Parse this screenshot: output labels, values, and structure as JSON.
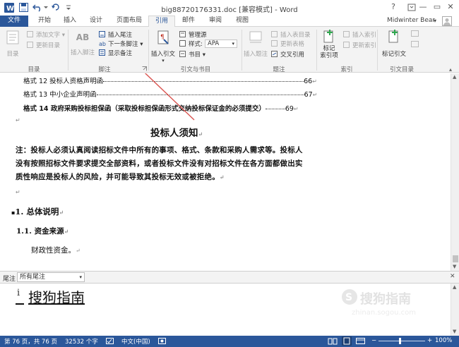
{
  "window": {
    "title": "big88720176331.doc [兼容模式] - Word",
    "help_glyph": "?",
    "min_glyph": "—",
    "restore_glyph": "▭",
    "close_glyph": "✕"
  },
  "tabs": {
    "file": "文件",
    "items": [
      "开始",
      "插入",
      "设计",
      "页面布局",
      "引用",
      "邮件",
      "审阅",
      "视图"
    ],
    "active": "引用",
    "user": "Midwinter Bear",
    "user_arrow": "▾"
  },
  "ribbon": {
    "toc": {
      "big": "目录",
      "add_text": "添加文字",
      "update": "更新目录",
      "group": "目录"
    },
    "footnotes": {
      "big": "插入脚注",
      "ab_glyph": "AB",
      "insert_endnote": "插入尾注",
      "next_footnote": "下一条脚注",
      "show_notes": "显示备注",
      "group": "脚注"
    },
    "citations": {
      "big": "插入引文",
      "manage": "管理源",
      "style_label": "样式:",
      "style_value": "APA",
      "bibliography": "书目",
      "group": "引文与书目"
    },
    "captions": {
      "big": "插入题注",
      "insert_table": "插入表目录",
      "update_table": "更新表格",
      "cross_ref": "交叉引用",
      "group": "题注"
    },
    "index": {
      "mark": "标记\n索引项",
      "insert": "插入索引",
      "update": "更新索引",
      "group": "索引"
    },
    "authorities": {
      "mark": "标记引文",
      "group": "引文目录"
    }
  },
  "document": {
    "toc_lines": [
      {
        "text": "格式 12 投标人资格声明函",
        "page": "66"
      },
      {
        "text": "格式 13 中小企业声明函",
        "page": "67"
      },
      {
        "text": "格式 14 政府采购投标担保函（采取投标担保函形式交纳投标保证金的必须提交）",
        "page": "69"
      }
    ],
    "heading": "投标人须知",
    "note_lines": [
      "注：投标人必须认真阅读招标文件中所有的事项、格式、条款和采购人需求等。投标人",
      "没有按照招标文件要求提交全部资料，或者投标文件没有对招标文件在各方面都做出实",
      "质性响应是投标人的风险，并可能导致其投标无效或被拒绝。"
    ],
    "section1": "1.  总体说明",
    "section11": "1.1. 资金来源",
    "body1": "财政性资金。",
    "para_mark": "↵"
  },
  "footnote_pane": {
    "label": "尾注",
    "select_value": "所有尾注",
    "close_glyph": "✕",
    "note_mark": "i",
    "note_text": "搜狗指南",
    "watermark": "搜狗指南",
    "watermark_url": "zhinan.sogou.com"
  },
  "statusbar": {
    "page": "第 76 页，共 76 页",
    "words": "32532 个字",
    "language": "中文(中国)",
    "zoom": "100%",
    "zoom_minus": "−",
    "zoom_plus": "+"
  },
  "colors": {
    "accent": "#2b579a",
    "arrow": "#d9534f"
  }
}
